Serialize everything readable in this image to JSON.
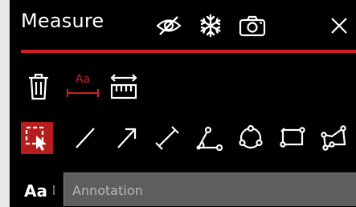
{
  "header": {
    "title": "Measure",
    "icons": [
      "eye-slash-icon",
      "snowflake-icon",
      "camera-icon",
      "close-icon"
    ]
  },
  "tools_row1": {
    "icons": [
      "trash-icon",
      "text-label-icon",
      "ruler-icon"
    ],
    "text_label_glyph": "Aa"
  },
  "tools_row2": {
    "selected": "select-tool",
    "icons": [
      "select-tool",
      "line-tool",
      "arrow-tool",
      "distance-tool",
      "angle-tool",
      "circle-tool",
      "rectangle-tool",
      "polygon-tool"
    ]
  },
  "annotation": {
    "font_glyph": "Aa",
    "placeholder": "Annotation"
  },
  "colors": {
    "accent": "#d01f25",
    "selected_bg": "#b81d1d",
    "panel_bg": "#000000",
    "input_bg": "#5e5e5e"
  }
}
